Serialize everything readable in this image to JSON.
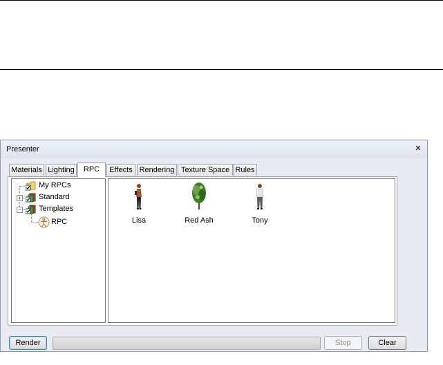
{
  "window": {
    "title": "Presenter",
    "close_glyph": "×"
  },
  "tabs": [
    {
      "label": "Materials",
      "active": false
    },
    {
      "label": "Lighting",
      "active": false
    },
    {
      "label": "RPC",
      "active": true
    },
    {
      "label": "Effects",
      "active": false
    },
    {
      "label": "Rendering",
      "active": false
    },
    {
      "label": "Texture Space",
      "active": false
    },
    {
      "label": "Rules",
      "active": false
    }
  ],
  "tree": {
    "items": [
      {
        "label": "My RPCs",
        "icon": "folder-checked-icon",
        "expander": null
      },
      {
        "label": "Standard",
        "icon": "library-checked-icon",
        "expander": "+"
      },
      {
        "label": "Templates",
        "icon": "library-checked-icon",
        "expander": "−"
      },
      {
        "label": "RPC",
        "icon": "person-template-icon",
        "expander": null
      }
    ]
  },
  "rpc_items": [
    {
      "label": "Lisa",
      "icon": "person-figure-icon"
    },
    {
      "label": "Red Ash",
      "icon": "tree-icon"
    },
    {
      "label": "Tony",
      "icon": "person-figure-icon"
    }
  ],
  "buttons": {
    "render": "Render",
    "stop": "Stop",
    "clear": "Clear"
  },
  "progress": {
    "value": 0
  },
  "colors": {
    "window_bg": "#e8ebf1",
    "window_border": "#8e9bb3",
    "default_button_border": "#3c7fb1"
  }
}
